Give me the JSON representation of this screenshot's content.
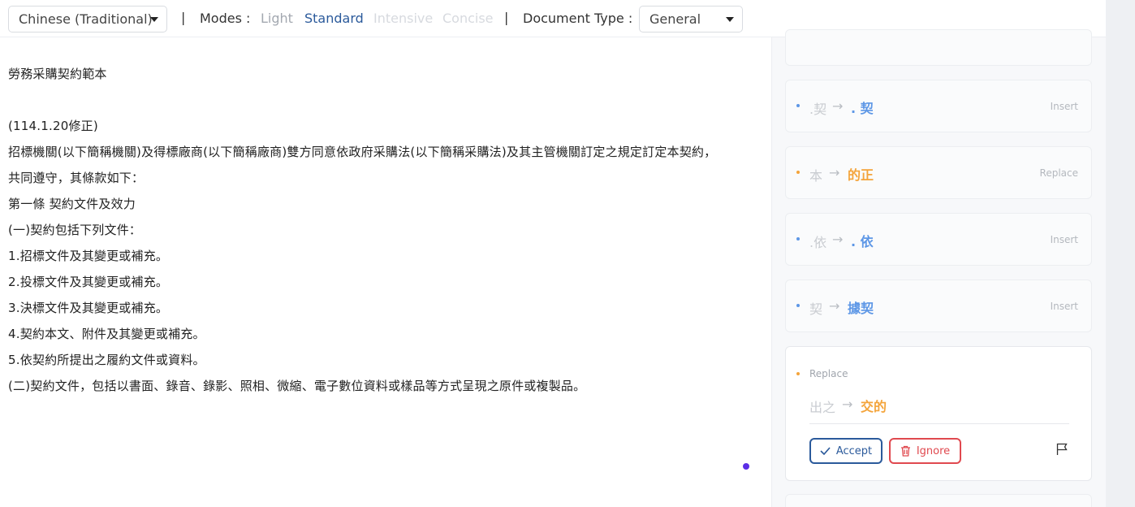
{
  "toolbar": {
    "language": "Chinese (Traditional)",
    "separator": "|",
    "modes_label": "Modes :",
    "modes": [
      "Light",
      "Standard",
      "Intensive",
      "Concise"
    ],
    "doc_type_label": "Document Type :",
    "doc_type": "General"
  },
  "document": {
    "lines": [
      "勞務采購契約範本",
      "(114.1.20修正)",
      "招標機關(以下簡稱機關)及得標廠商(以下簡稱廠商)雙方同意依政府采購法(以下簡稱采購法)及其主管機關訂定之規定訂定本契約，",
      "共同遵守，其條款如下：",
      "第一條 契約文件及效力",
      "(一)契約包括下列文件：",
      "1.招標文件及其變更或補充。",
      "2.投標文件及其變更或補充。",
      "3.決標文件及其變更或補充。",
      "4.契約本文、附件及其變更或補充。",
      "5.依契約所提出之履約文件或資料。",
      "(二)契約文件，包括以書面、錄音、錄影、照相、微縮、電子數位資料或樣品等方式呈現之原件或複製品。"
    ]
  },
  "suggestions": [
    {
      "from": ".契",
      "to": ". 契",
      "action": "Insert",
      "color": "#5d97e6"
    },
    {
      "from": "本",
      "to": "的正",
      "action": "Replace",
      "color": "#f4a43b"
    },
    {
      "from": ".依",
      "to": ". 依",
      "action": "Insert",
      "color": "#5d97e6"
    },
    {
      "from": "契",
      "to": "據契",
      "action": "Insert",
      "color": "#5d97e6"
    }
  ],
  "expanded": {
    "action": "Replace",
    "from": "出之",
    "to": "交的",
    "accept_label": "Accept",
    "ignore_label": "Ignore"
  },
  "arrow": "→",
  "colors": {
    "blue_underline": "#5d97e6",
    "orange_underline": "#f4a43b",
    "accent": "#2b5a9b",
    "danger": "#e0494f"
  }
}
